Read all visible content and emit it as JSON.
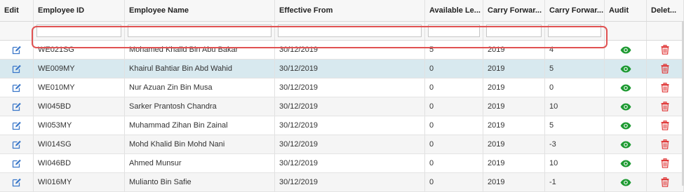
{
  "columns": {
    "edit": "Edit",
    "employee_id": "Employee ID",
    "employee_name": "Employee Name",
    "effective_from": "Effective From",
    "available_leave": "Available Le...",
    "carry_forward_year": "Carry Forwar...",
    "carry_forward_days": "Carry Forwar...",
    "audit": "Audit",
    "delete": "Delet..."
  },
  "filters": {
    "employee_id": "",
    "employee_name": "",
    "effective_from": "",
    "available_leave": "",
    "carry_forward_year": "",
    "carry_forward_days": ""
  },
  "icons": {
    "edit": "edit-icon",
    "audit": "eye-icon",
    "delete": "trash-icon"
  },
  "colors": {
    "edit": "#3a77c9",
    "audit": "#1e9a32",
    "delete": "#e03a3a",
    "selected_row": "#d8e9ef",
    "highlight": "#e05252"
  },
  "rows": [
    {
      "id": "WE021SG",
      "name": "Mohamed Khalid Bin Abu Bakar",
      "effective": "30/12/2019",
      "available": "5",
      "cf_year": "2019",
      "cf_days": "4"
    },
    {
      "id": "WE009MY",
      "name": "Khairul Bahtiar Bin Abd Wahid",
      "effective": "30/12/2019",
      "available": "0",
      "cf_year": "2019",
      "cf_days": "5"
    },
    {
      "id": "WE010MY",
      "name": "Nur Azuan Zin Bin Musa",
      "effective": "30/12/2019",
      "available": "0",
      "cf_year": "2019",
      "cf_days": "0"
    },
    {
      "id": "WI045BD",
      "name": "Sarker Prantosh Chandra",
      "effective": "30/12/2019",
      "available": "0",
      "cf_year": "2019",
      "cf_days": "10"
    },
    {
      "id": "WI053MY",
      "name": "Muhammad Zihan Bin Zainal",
      "effective": "30/12/2019",
      "available": "0",
      "cf_year": "2019",
      "cf_days": "5"
    },
    {
      "id": "WI014SG",
      "name": "Mohd Khalid Bin Mohd Nani",
      "effective": "30/12/2019",
      "available": "0",
      "cf_year": "2019",
      "cf_days": "-3"
    },
    {
      "id": "WI046BD",
      "name": "Ahmed Munsur",
      "effective": "30/12/2019",
      "available": "0",
      "cf_year": "2019",
      "cf_days": "10"
    },
    {
      "id": "WI016MY",
      "name": "Mulianto Bin Safie",
      "effective": "30/12/2019",
      "available": "0",
      "cf_year": "2019",
      "cf_days": "-1"
    }
  ]
}
